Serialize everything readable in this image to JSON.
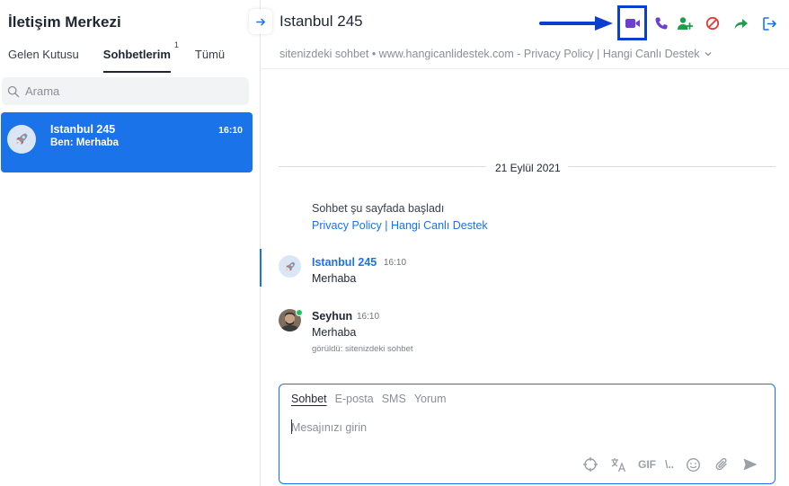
{
  "sidebar": {
    "title": "İletişim Merkezi",
    "tabs": [
      {
        "label": "Gelen Kutusu",
        "badge": ""
      },
      {
        "label": "Sohbetlerim",
        "badge": "1"
      },
      {
        "label": "Tümü",
        "badge": ""
      }
    ],
    "search_placeholder": "Arama",
    "conversations": [
      {
        "name": "Istanbul 245",
        "preview": "Ben: Merhaba",
        "time": "16:10"
      }
    ]
  },
  "header": {
    "title": "Istanbul 245",
    "subtitle": "sitenizdeki sohbet • www.hangicanlidestek.com - Privacy Policy | Hangi Canlı Destek"
  },
  "actions": {
    "icons": [
      "video-call-icon",
      "phone-icon",
      "add-user-icon",
      "block-icon",
      "forward-icon",
      "exit-icon"
    ],
    "colors": {
      "video": "#6c3fd1",
      "phone": "#6c3fd1",
      "add_user": "#1e9e4a",
      "block": "#e53935",
      "forward": "#1e9e4a",
      "exit": "#1a73e8"
    }
  },
  "chat": {
    "date": "21 Eylül 2021",
    "system_text": "Sohbet şu sayfada başladı",
    "system_link": "Privacy Policy | Hangi Canlı Destek",
    "messages": [
      {
        "sender": "Istanbul 245",
        "time": "16:10",
        "text": "Merhaba",
        "seen": ""
      },
      {
        "sender": "Seyhun",
        "time": "16:10",
        "text": "Merhaba",
        "seen": "görüldü: sitenizdeki sohbet"
      }
    ]
  },
  "composer": {
    "tabs": [
      "Sohbet",
      "E-posta",
      "SMS",
      "Yorum"
    ],
    "placeholder": "Mesajınızı girin",
    "gif_label": "GIF",
    "shortcut_label": "\\.."
  },
  "colors": {
    "accent": "#1a73e8",
    "highlight_box": "#0b3fd0",
    "online": "#21c15a"
  }
}
